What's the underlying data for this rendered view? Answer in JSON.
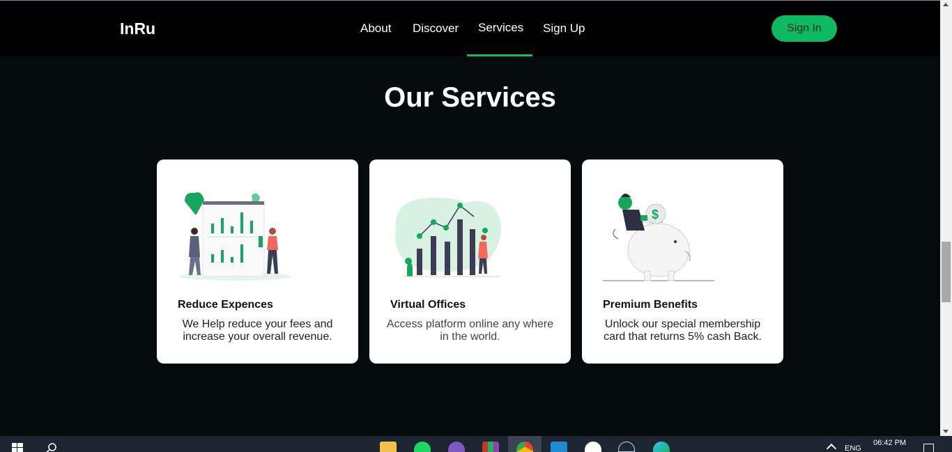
{
  "navbar": {
    "brand": "InRu",
    "links": [
      "About",
      "Discover",
      "Services",
      "Sign Up"
    ],
    "active_link": "Services",
    "signin_label": "Sign In",
    "accent_color": "#0fb964"
  },
  "main": {
    "title": "Our Services",
    "cards": [
      {
        "title": "Reduce Expences",
        "description": "We Help reduce your fees and increase your overall revenue.",
        "illustration": "analytics-board-icon"
      },
      {
        "title": "Virtual Offices",
        "description": "Access platform online any where in the world.",
        "illustration": "growth-chart-icon"
      },
      {
        "title": "Premium Benefits",
        "description": "Unlock our special membership card that returns 5% cash Back.",
        "illustration": "piggy-bank-icon"
      }
    ]
  },
  "taskbar": {
    "apps": [
      "file-explorer-icon",
      "spotify-icon",
      "tor-icon",
      "winrar-icon",
      "chrome-icon",
      "vscode-icon",
      "signal-icon",
      "steam-icon",
      "edge-icon"
    ],
    "language": "ENG",
    "time": "06:42 PM"
  }
}
